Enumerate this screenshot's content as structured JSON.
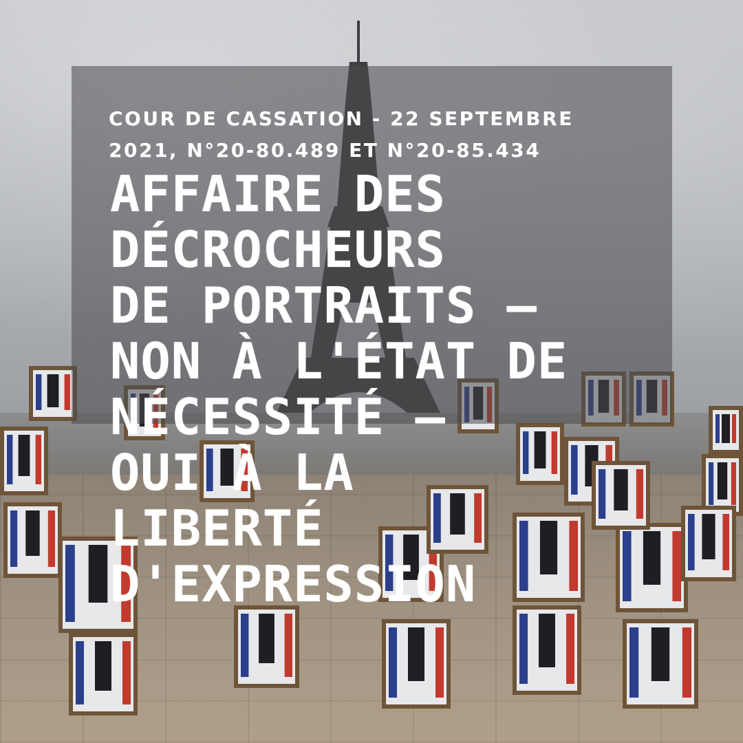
{
  "post": {
    "subtitle": "COUR DE CASSATION - 22 SEPTEMBRE 2021, N°20-80.489 ET N°20-85.434",
    "headline_lines": [
      "AFFAIRE DES",
      "DÉCROCHEURS",
      "DE PORTRAITS –",
      "NON À L'ÉTAT DE",
      "NÉCESSITÉ –",
      "OUI À LA",
      "LIBERTÉ",
      "D'EXPRESSION"
    ]
  },
  "colors": {
    "overlay": "#4b4b4e",
    "text": "#ffffff"
  }
}
